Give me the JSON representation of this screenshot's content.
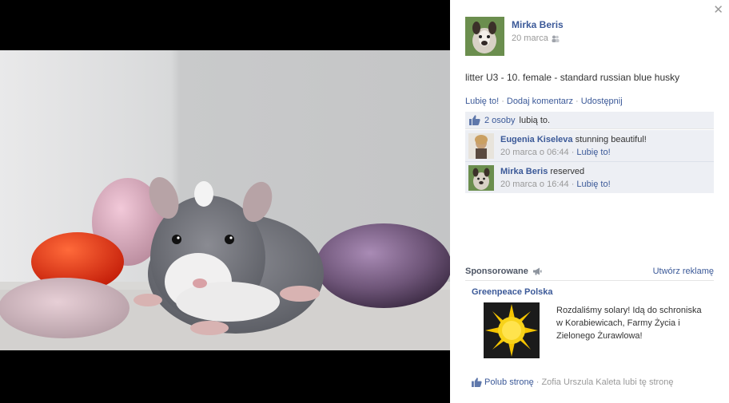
{
  "post": {
    "author": "Mirka Beris",
    "date": "20 marca",
    "caption": "litter U3 - 10. female - standard russian blue husky",
    "actions": [
      "Lubię to!",
      "Dodaj komentarz",
      "Udostępnij"
    ],
    "likes_count": "2 osoby",
    "likes_suffix": "lubią to."
  },
  "comments": [
    {
      "author": "Eugenia Kiseleva",
      "text": "stunning beautiful!",
      "time": "20 marca o 06:44",
      "like": "Lubię to!"
    },
    {
      "author": "Mirka Beris",
      "text": "reserved",
      "time": "20 marca o 16:44",
      "like": "Lubię to!"
    }
  ],
  "sponsored": {
    "title": "Sponsorowane",
    "create_ad": "Utwórz reklamę",
    "page_name": "Greenpeace Polska",
    "text": "Rozdaliśmy solary! Idą do schroniska w Korabiewicach, Farmy Życia i Zielonego Żurawlowa!",
    "like_page": "Polub stronę",
    "social": "Zofia Urszula Kaleta lubi tę stronę"
  },
  "icons": {
    "close": "close-icon",
    "audience": "friends-icon",
    "like": "thumbs-up-icon",
    "megaphone": "megaphone-icon"
  },
  "colors": {
    "link": "#3b5998",
    "ufi_bg": "#edeff4",
    "stage_bg": "#000000"
  }
}
